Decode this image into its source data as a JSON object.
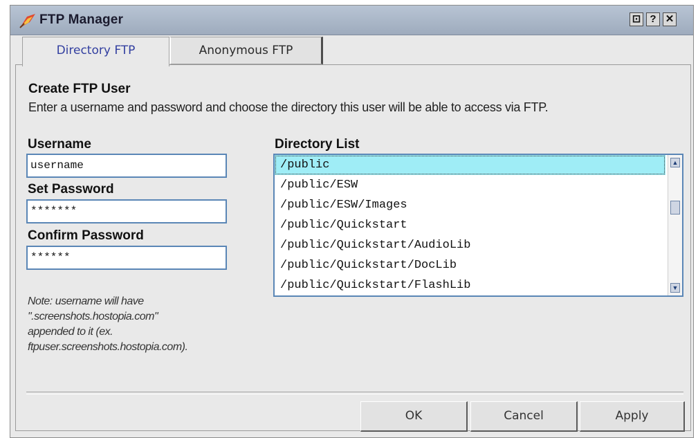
{
  "window": {
    "title": "FTP Manager",
    "icon": "ftp-manager-icon",
    "controls": [
      {
        "name": "minimize-button",
        "label": "⊡",
        "icon": "minimize-icon"
      },
      {
        "name": "help-button",
        "label": "?",
        "icon": "help-icon"
      },
      {
        "name": "close-button",
        "label": "✕",
        "icon": "close-icon"
      }
    ]
  },
  "tabs": [
    {
      "label": "Directory FTP",
      "active": true
    },
    {
      "label": "Anonymous FTP",
      "active": false
    }
  ],
  "form": {
    "heading": "Create FTP User",
    "description": "Enter a username and password and choose the directory this user will be able to access via FTP.",
    "username_label": "Username",
    "username_value": "username",
    "password_label": "Set Password",
    "password_value": "*******",
    "confirm_label": "Confirm Password",
    "confirm_value": "******",
    "note_lines": [
      "Note: username will have",
      "\".screenshots.hostopia.com\"",
      "appended to it (ex.",
      "ftpuser.screenshots.hostopia.com)."
    ]
  },
  "directory": {
    "label": "Directory List",
    "items": [
      "/public",
      "/public/ESW",
      "/public/ESW/Images",
      "/public/Quickstart",
      "/public/Quickstart/AudioLib",
      "/public/Quickstart/DocLib",
      "/public/Quickstart/FlashLib"
    ],
    "selected": "/public"
  },
  "buttons": {
    "ok": "OK",
    "cancel": "Cancel",
    "apply": "Apply"
  },
  "colors": {
    "titlebar": "#a8b5c7",
    "selection": "#9fedf6",
    "active_tab_text": "#323fa0",
    "input_border": "#5a86b6"
  }
}
